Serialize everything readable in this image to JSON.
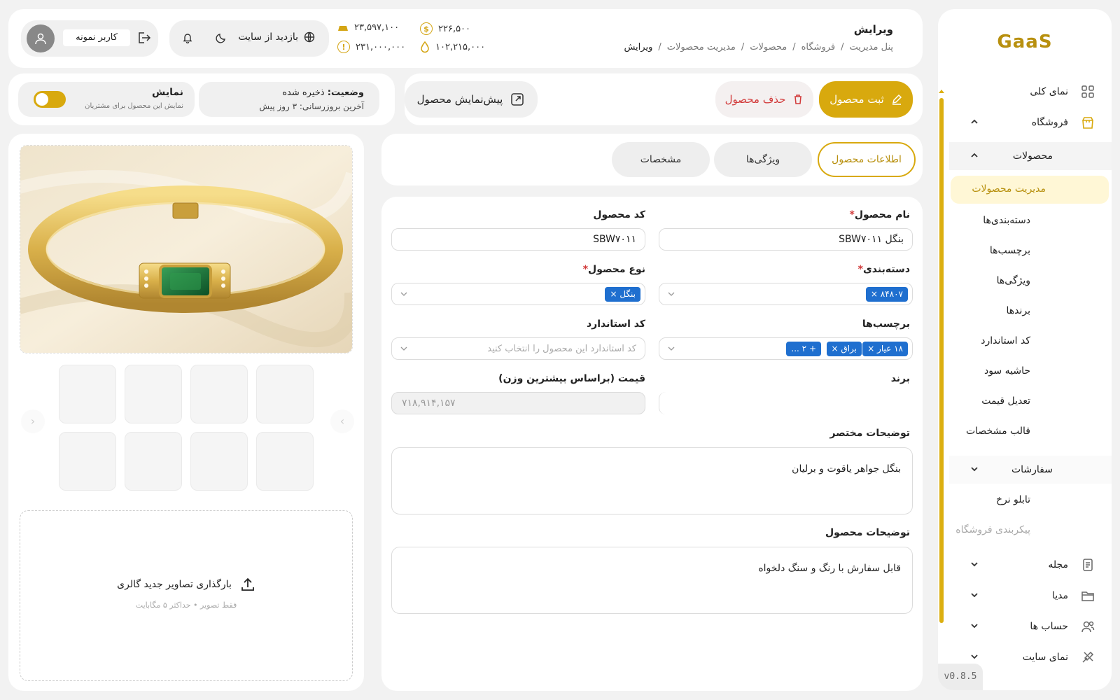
{
  "brand": {
    "logo": "GaaS",
    "version": "v0.8.5",
    "accent": "#d8a90e"
  },
  "sidebar": {
    "items": [
      {
        "label": "نمای کلی",
        "icon": "grid-icon"
      },
      {
        "label": "فروشگاه",
        "icon": "store-icon"
      },
      {
        "label": "محصولات"
      },
      {
        "label": "سفارشات"
      },
      {
        "label": "مجله",
        "icon": "document-icon"
      },
      {
        "label": "مدیا",
        "icon": "folder-icon"
      },
      {
        "label": "حساب ها",
        "icon": "users-icon"
      },
      {
        "label": "نمای سایت",
        "icon": "palette-icon"
      }
    ],
    "product_sub": [
      "مدیریت محصولات",
      "دسته‌بندی‌ها",
      "برچسب‌ها",
      "ویژگی‌ها",
      "برندها",
      "کد استاندارد",
      "حاشیه سود",
      "تعدیل قیمت",
      "قالب مشخصات"
    ],
    "orders_sub": [
      "تابلو نرخ",
      "پیکربندی فروشگاه"
    ]
  },
  "header": {
    "title": "ویرایش",
    "breadcrumbs": [
      "پنل مدیریت",
      "فروشگاه",
      "محصولات",
      "مدیریت محصولات",
      "ویرایش"
    ],
    "stats": {
      "gold_bar": "۲۳,۵۹۷,۱۰۰",
      "dollar": "۲۲۶,۵۰۰",
      "coin": "۲۳۱,۰۰۰,۰۰۰",
      "drop": "۱۰۲,۲۱۵,۰۰۰"
    },
    "visit_site": "بازدید از سایت",
    "user_name": "کاربر نمونه"
  },
  "actions": {
    "save": "ثبت محصول",
    "delete": "حذف محصول",
    "preview": "پیش‌نمایش محصول"
  },
  "status": {
    "label": "وضعیت:",
    "value": "ذخیره شده",
    "updated": "آخرین بروزرسانی: ۳ روز پیش",
    "display_title": "نمایش",
    "display_desc": "نمایش این محصول برای مشتریان",
    "display_on": true
  },
  "tabs": [
    "اطلاعات محصول",
    "ویژگی‌ها",
    "مشخصات"
  ],
  "form": {
    "name_label": "نام محصول",
    "name_value": "بنگل SBW۷۰۱۱",
    "code_label": "کد محصول",
    "code_value": "SBW۷۰۱۱",
    "category_label": "دسته‌بندی",
    "category_chip": "۸۴۸۰۷ ×",
    "type_label": "نوع محصول",
    "type_chip": "بنگل ×",
    "tags_label": "برچسب‌ها",
    "tags": [
      "۱۸ عیار ×",
      "براق ×",
      "+ ۲ ..."
    ],
    "std_label": "کد استاندارد",
    "std_placeholder": "کد استاندارد این محصول را انتخاب کنید",
    "brand_label": "برند",
    "price_label": "قیمت (براساس بیشترین وزن)",
    "price_value": "۷۱۸,۹۱۴,۱۵۷",
    "short_desc_label": "توضیحات مختصر",
    "short_desc_value": "بنگل جواهر یاقوت و برلیان",
    "desc_label": "توضیحات محصول",
    "desc_value": "قابل سفارش با رنگ و سنگ دلخواه"
  },
  "gallery": {
    "upload_title": "بارگذاری تصاویر جدید گالری",
    "upload_hint": "فقط تصویر • حداکثر ۵ مگابایت",
    "prev": "‹",
    "next": "›"
  }
}
